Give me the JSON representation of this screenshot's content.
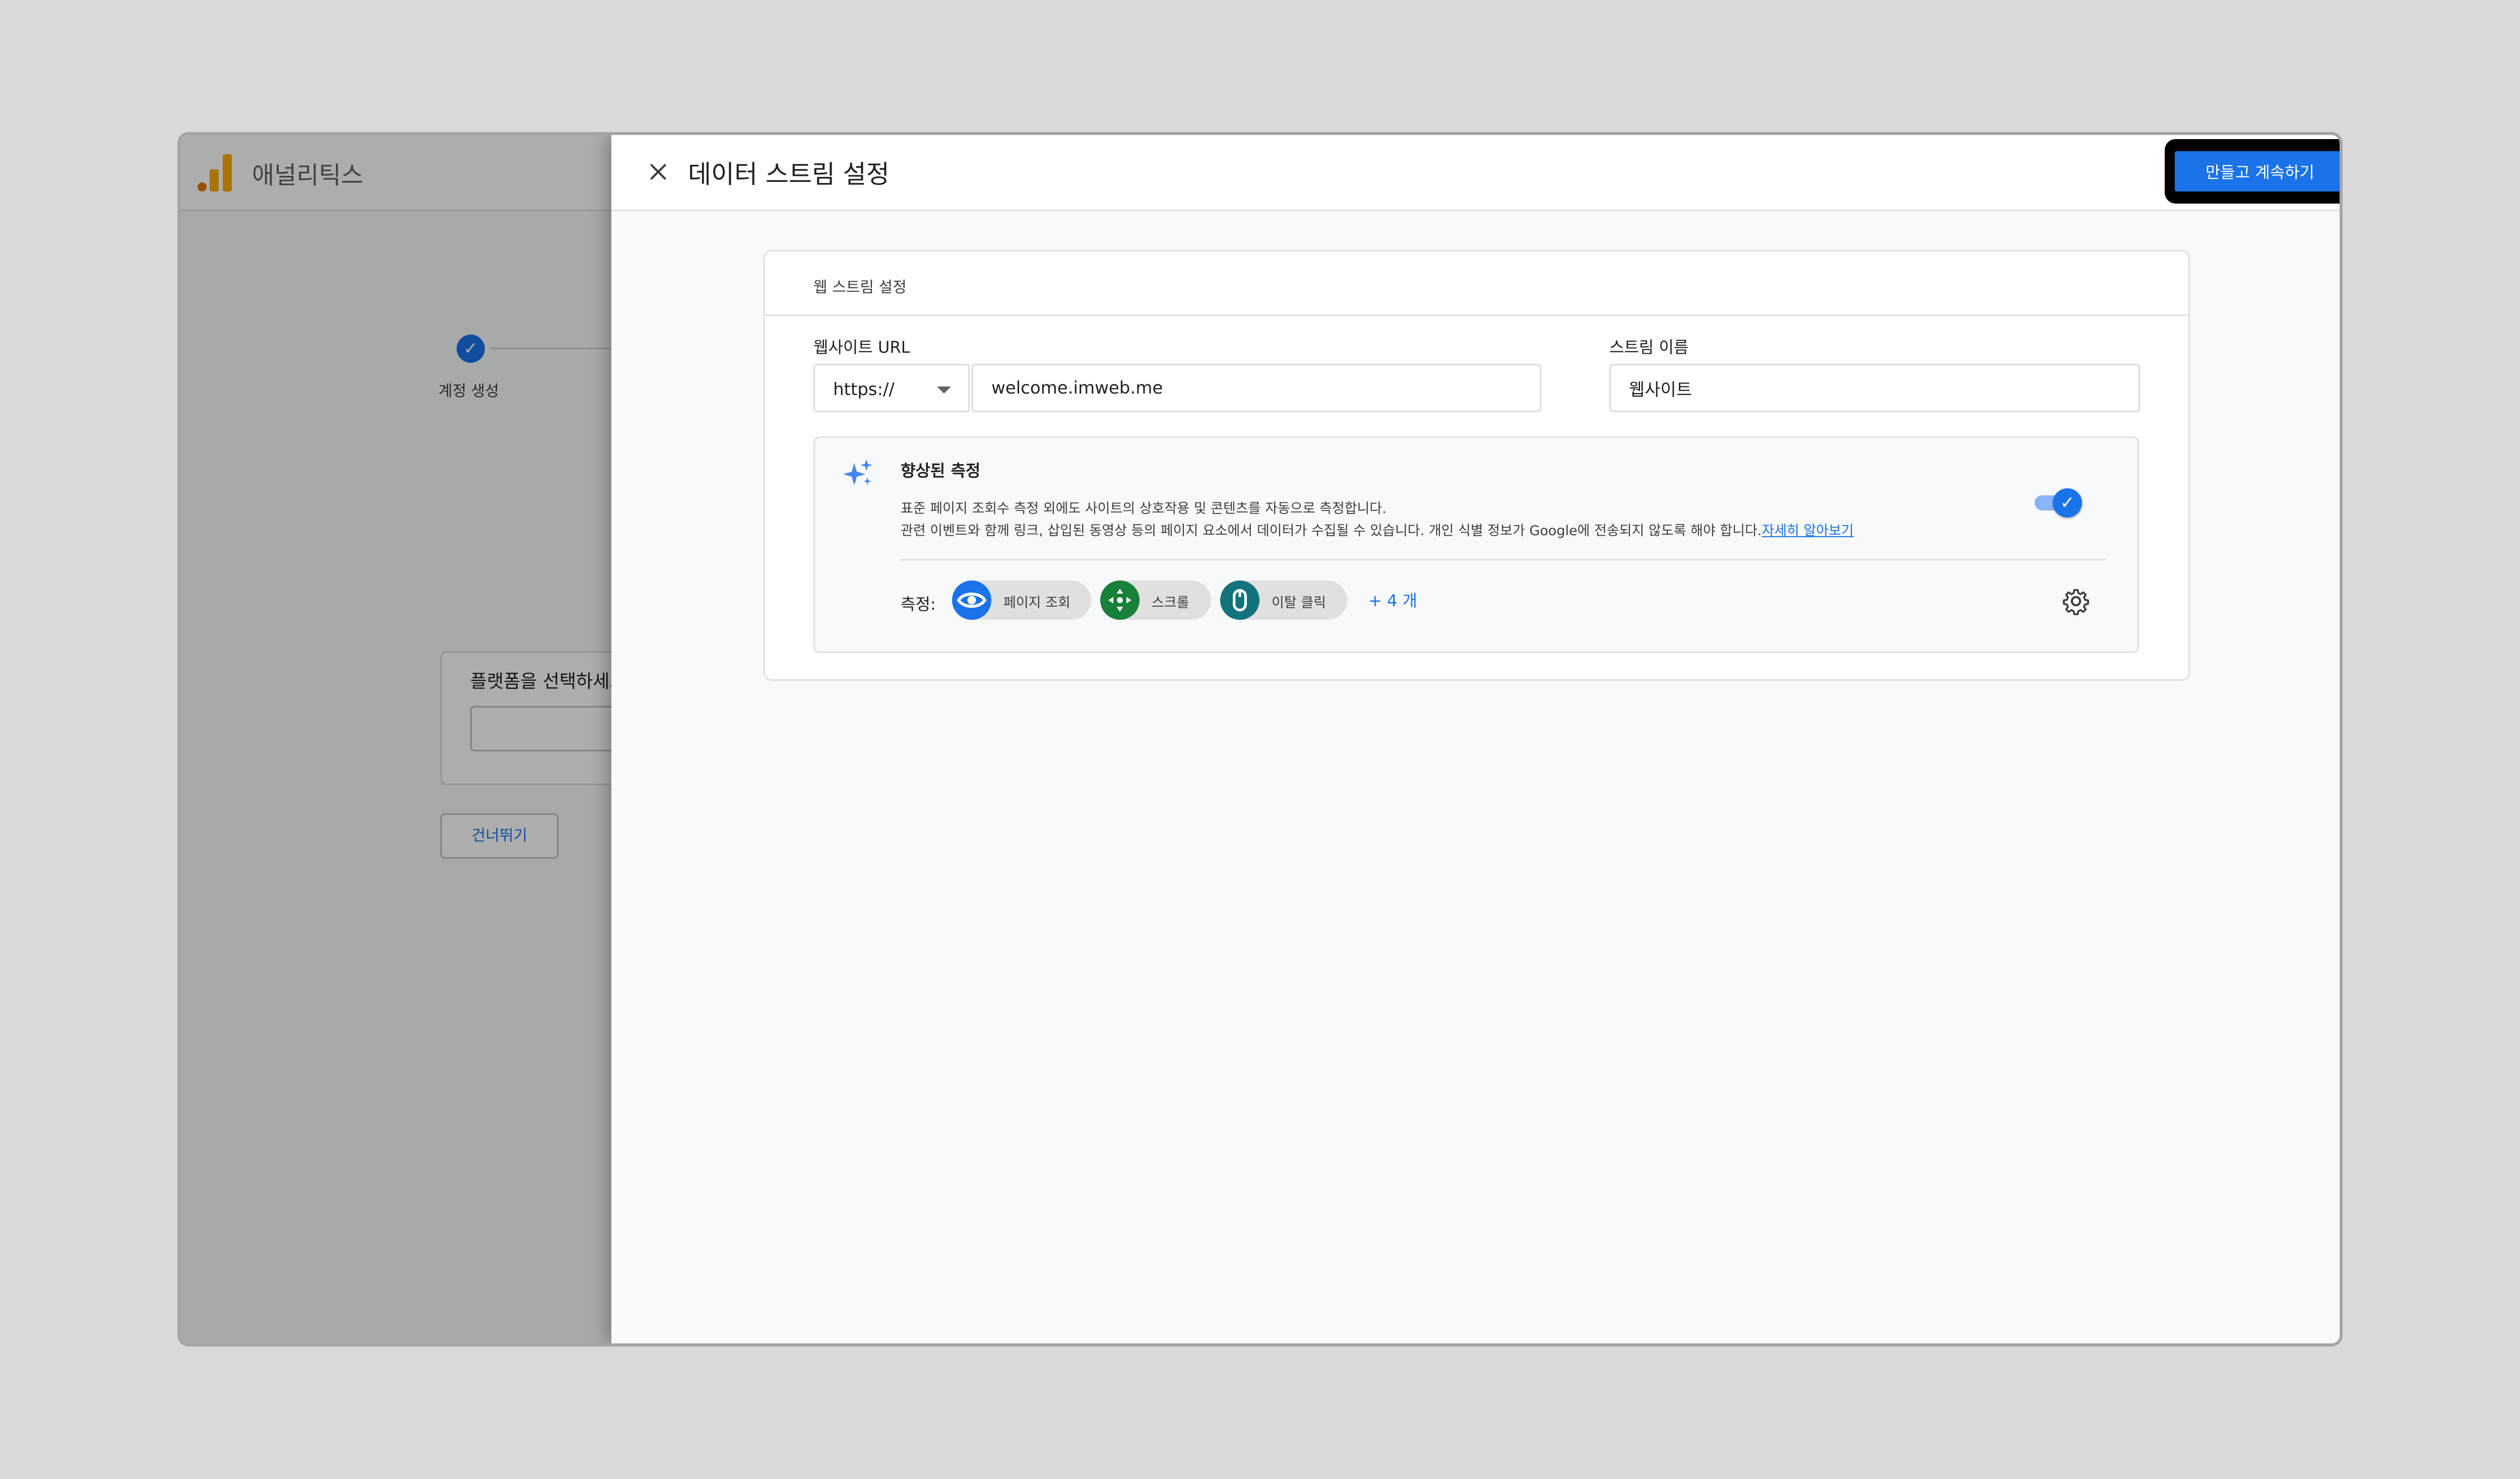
{
  "app": {
    "title": "애널리틱스"
  },
  "background": {
    "stepper_label": "계정 생성",
    "platform_prompt": "플랫폼을 선택하세요",
    "skip_label": "건너뛰기"
  },
  "modal": {
    "title": "데이터 스트림 설정",
    "create_button": "만들고 계속하기",
    "section_title": "웹 스트림 설정",
    "website_url_label": "웹사이트 URL",
    "protocol_value": "https://",
    "url_value": "welcome.imweb.me",
    "stream_name_label": "스트림 이름",
    "stream_name_value": "웹사이트",
    "enhanced": {
      "title": "향상된 측정",
      "desc_line1": "표준 페이지 조회수 측정 외에도 사이트의 상호작용 및 콘텐츠를 자동으로 측정합니다.",
      "desc_line2": "관련 이벤트와 함께 링크, 삽입된 동영상 등의 페이지 요소에서 데이터가 수집될 수 있습니다. 개인 식별 정보가 Google에 전송되지 않도록 해야 합니다.",
      "learn_more": "자세히 알아보기",
      "toggle_on": true,
      "measure_label": "측정:",
      "chips": [
        {
          "label": "페이지 조회",
          "icon": "eye-icon",
          "color": "#1a73e8"
        },
        {
          "label": "스크롤",
          "icon": "scroll-move-icon",
          "color": "#188038"
        },
        {
          "label": "이탈 클릭",
          "icon": "mouse-icon",
          "color": "#12737a"
        }
      ],
      "more": "+ 4 개"
    }
  },
  "colors": {
    "accent": "#1a73e8",
    "ga_orange": "#f9ab00"
  }
}
